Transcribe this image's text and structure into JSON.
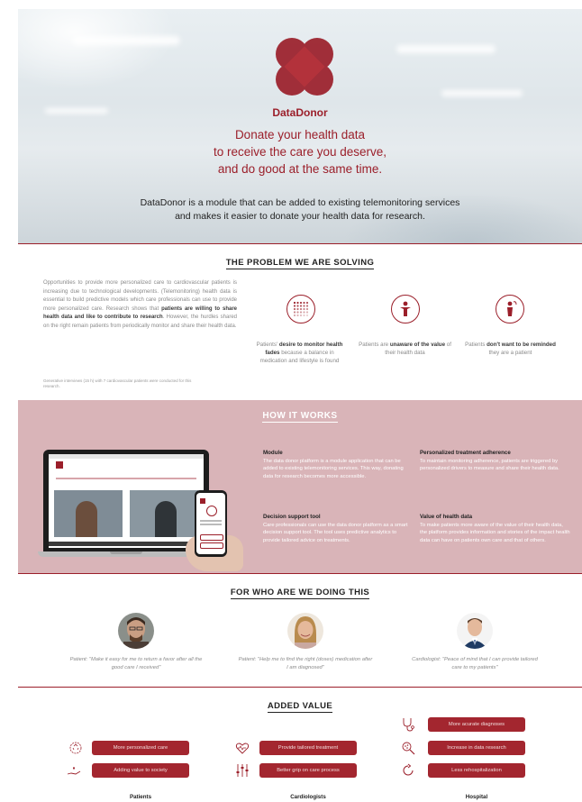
{
  "brand": {
    "name": "DataDonor",
    "color": "#9b1f2a"
  },
  "hero": {
    "tagline": [
      "Donate your health data",
      "to receive the care you deserve,",
      "and do good at the same time."
    ],
    "intro": [
      "DataDonor is a module that can be added to existing telemonitoring services",
      "and makes it easier to donate your health data for research."
    ]
  },
  "problem": {
    "title": "THE PROBLEM WE ARE SOLVING",
    "text_parts": [
      "Opportunities to provide more personalized care to cardiovascular patients is increasing due to technological developments. (Telemonitoring) health data is essential to build predictive models which care professionals can use to provide more personalized care. Research shows that ",
      "patients are willing to share health data and like to contribute to research",
      ". However, the hurdles shared on the right remain patients from periodically monitor and share their health data."
    ],
    "note": "Generative interviews (15 h) with 7 cardiovascular patients were conducted for this research.",
    "cards": [
      {
        "icon": "dots-fade-icon",
        "pre": "Patients' ",
        "bold": "desire to monitor health fades",
        "post": " because a balance in medication and lifestyle is found"
      },
      {
        "icon": "person-icon",
        "pre": "Patients are ",
        "bold": "unaware of the value",
        "post": " of their health data"
      },
      {
        "icon": "person-bell-icon",
        "pre": "Patients ",
        "bold": "don't want to be reminded",
        "post": " they are a patient"
      }
    ]
  },
  "how": {
    "title": "HOW IT WORKS",
    "items": [
      {
        "heading": "Module",
        "text": "The data donor platform is a module application that can be added to existing telemonitoring services. This way, donating data for research becomes more accessible."
      },
      {
        "heading": "Personalized treatment adherence",
        "text": "To maintain monitoring adherence, patients are triggered by personalized drivers to measure and share their health data."
      },
      {
        "heading": "Decision support tool",
        "text": "Care professionals can use the data donor platform as a smart decision support tool. The tool uses predictive analytics to provide tailored advice on treatments."
      },
      {
        "heading": "Value of health data",
        "text": "To make patients more aware of the value of their health data, the platform provides information and stories of the impact health data can have on patients own care and that of others."
      }
    ]
  },
  "forwho": {
    "title": "FOR WHO ARE WE DOING THIS",
    "personas": [
      {
        "quote": "Patient: \"Make it easy for me to return a favor after all the good care I received\""
      },
      {
        "quote": "Patient: \"Help me to find the right (doses) medication after I am diagnosed\""
      },
      {
        "quote": "Cardiologist: \"Peace of mind that I can provide tailored care to my patients\""
      }
    ]
  },
  "added": {
    "title": "ADDED VALUE",
    "patients": {
      "label": "Patients",
      "items": [
        "More personalized care",
        "Adding value to society"
      ]
    },
    "cardiologists": {
      "label": "Cardiologists",
      "items": [
        "Provide tailored treatment",
        "Better grip on care process"
      ]
    },
    "hospital": {
      "label": "Hospital",
      "items": [
        "More acurate diagnoses",
        "Increase in data research",
        "Less rehospitalization"
      ]
    }
  }
}
